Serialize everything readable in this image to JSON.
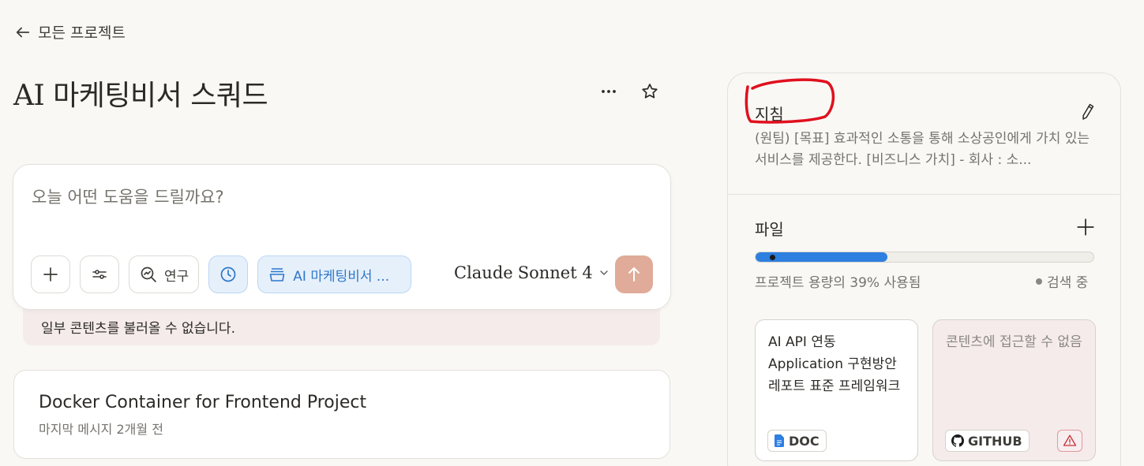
{
  "nav": {
    "back_label": "모든 프로젝트"
  },
  "project": {
    "title": "AI 마케팅비서 스쿼드"
  },
  "composer": {
    "placeholder": "오늘 어떤 도움을 드릴까요?",
    "research_label": "연구",
    "project_chip": "AI 마케팅비서 ...",
    "model_brand": "Claude",
    "model_name": "Sonnet 4"
  },
  "error": {
    "message": "일부 콘텐츠를 불러올 수 없습니다."
  },
  "chats": [
    {
      "title": "Docker Container for Frontend Project",
      "meta": "마지막 메시지 2개월 전"
    }
  ],
  "instructions": {
    "title": "지침",
    "text": "(원팀) [목표] 효과적인 소통을 통해 소상공인에게 가치 있는 서비스를 제공한다. [비즈니스 가치] - 회사 : 소..."
  },
  "files": {
    "title": "파일",
    "capacity_text": "프로젝트 용량의 39% 사용됨",
    "capacity_percent": 39,
    "search_status": "검색 중",
    "items": [
      {
        "title": "AI API 연동 Application 구현방안 레포트 표준 프레임워크",
        "badge": "DOC"
      },
      {
        "title": "콘텐츠에 접근할 수 없음",
        "badge": "GITHUB"
      }
    ]
  },
  "colors": {
    "accent_blue": "#2d7fe0",
    "send_button": "#e0ab98",
    "annotation_red": "#e0101e"
  }
}
